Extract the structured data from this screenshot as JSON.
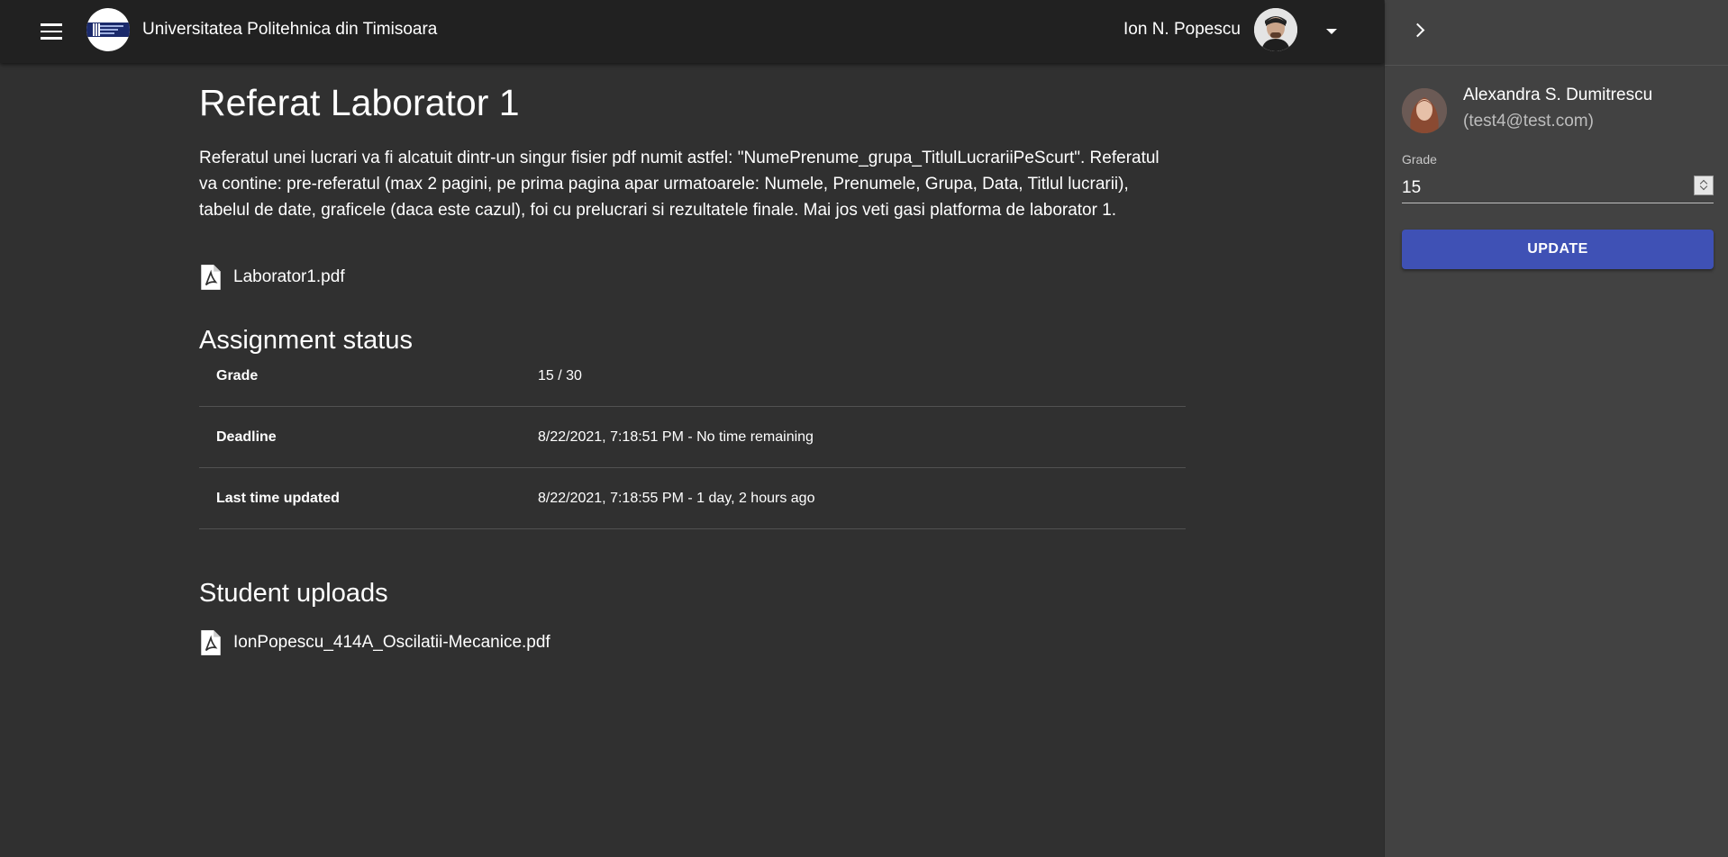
{
  "header": {
    "university_name": "Universitatea Politehnica din Timisoara",
    "user_name": "Ion N. Popescu",
    "menu_icon": "menu-icon",
    "dropdown_icon": "arrow-drop-down-icon"
  },
  "assignment": {
    "title": "Referat Laborator 1",
    "description": "Referatul unei lucrari va fi alcatuit dintr-un singur fisier pdf numit astfel: \"NumePrenume_grupa_TitlulLucrariiPeScurt\". Referatul va contine: pre-referatul (max 2 pagini, pe prima pagina apar urmatoarele: Numele, Prenumele, Grupa, Data, Titlul lucrarii), tabelul de date, graficele (daca este cazul), foi cu prelucrari si rezultatele finale. Mai jos veti gasi platforma de laborator 1.",
    "attachment": "Laborator1.pdf"
  },
  "status": {
    "section_title": "Assignment status",
    "rows": [
      {
        "label": "Grade",
        "value": "15 / 30"
      },
      {
        "label": "Deadline",
        "value": "8/22/2021, 7:18:51 PM - No time remaining"
      },
      {
        "label": "Last time updated",
        "value": "8/22/2021, 7:18:55 PM - 1 day, 2 hours ago"
      }
    ]
  },
  "uploads": {
    "section_title": "Student uploads",
    "files": [
      "IonPopescu_414A_Oscilatii-Mecanice.pdf"
    ]
  },
  "drawer": {
    "collapse_icon": "chevron-right-icon",
    "student_name": "Alexandra S. Dumitrescu",
    "student_email": "(test4@test.com)",
    "grade_label": "Grade",
    "grade_value": "15",
    "update_label": "UPDATE"
  },
  "colors": {
    "background": "#303030",
    "appbar": "#212121",
    "drawer": "#424242",
    "primary": "#3f51b5"
  }
}
